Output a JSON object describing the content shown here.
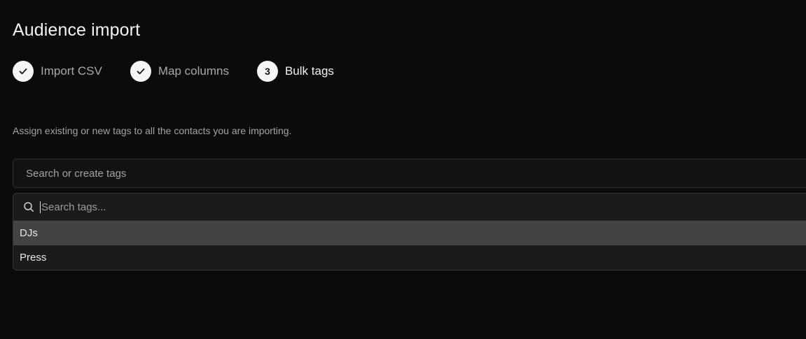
{
  "page": {
    "title": "Audience import"
  },
  "steps": [
    {
      "number": "",
      "label": "Import CSV",
      "state": "completed",
      "icon": "check-icon"
    },
    {
      "number": "",
      "label": "Map columns",
      "state": "completed",
      "icon": "check-icon"
    },
    {
      "number": "3",
      "label": "Bulk tags",
      "state": "current",
      "icon": ""
    }
  ],
  "help_text": "Assign existing or new tags to all the contacts you are importing.",
  "tag_select": {
    "placeholder": "Search or create tags"
  },
  "dropdown": {
    "search_placeholder": "Search tags...",
    "search_icon": "search-icon",
    "options": [
      {
        "label": "DJs",
        "highlighted": true
      },
      {
        "label": "Press",
        "highlighted": false
      }
    ]
  },
  "colors": {
    "background": "#0b0b0b",
    "step_circle": "#f5f5f5",
    "highlight": "#434343"
  }
}
